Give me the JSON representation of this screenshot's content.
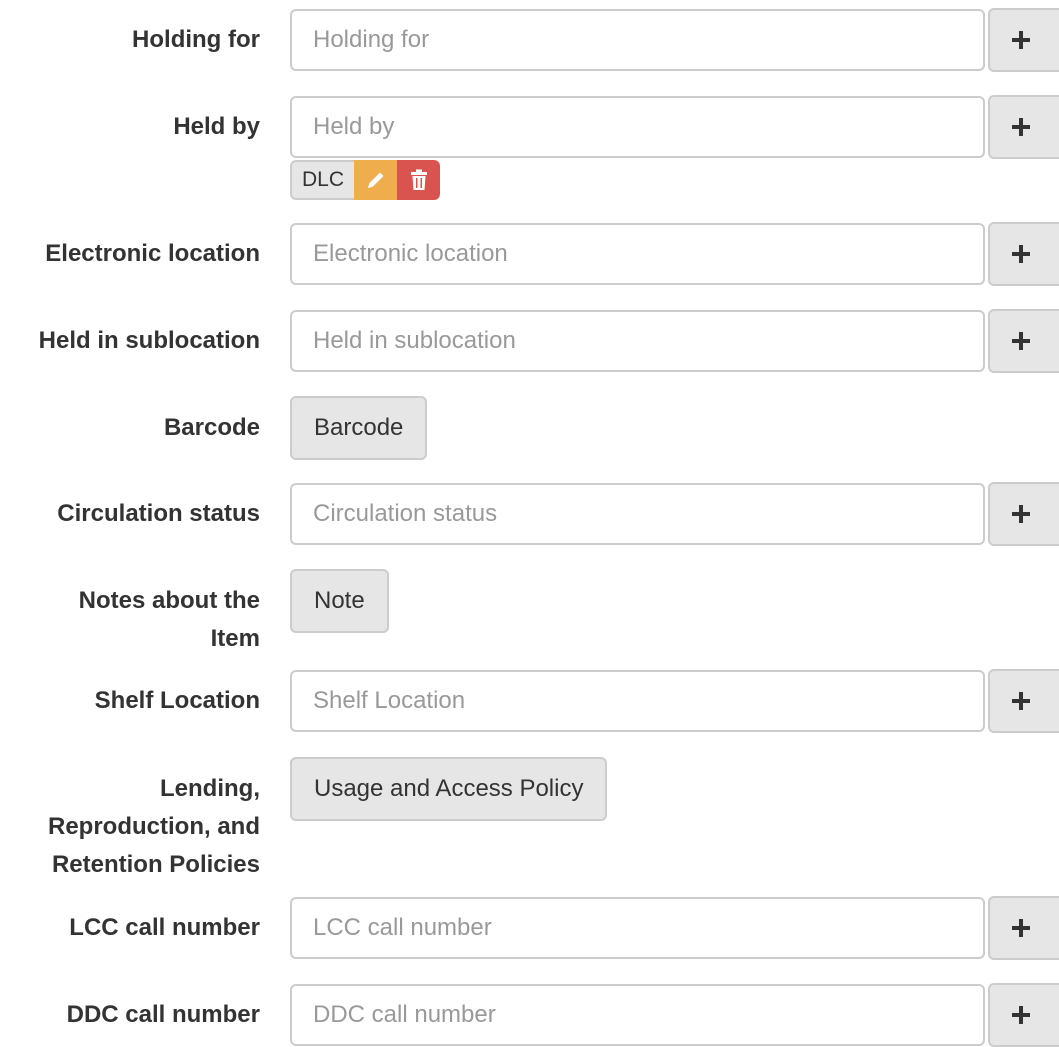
{
  "form": {
    "holding_for": {
      "label": "Holding for",
      "placeholder": "Holding for"
    },
    "held_by": {
      "label": "Held by",
      "placeholder": "Held by",
      "tag": {
        "text": "DLC",
        "edit_icon": "pencil-icon",
        "delete_icon": "trash-icon"
      }
    },
    "electronic_location": {
      "label": "Electronic location",
      "placeholder": "Electronic location"
    },
    "held_in_sublocation": {
      "label": "Held in sublocation",
      "placeholder": "Held in sublocation"
    },
    "barcode": {
      "label": "Barcode",
      "button": "Barcode"
    },
    "circulation_status": {
      "label": "Circulation status",
      "placeholder": "Circulation status"
    },
    "notes": {
      "label_line1": "Notes about the",
      "label_line2": "Item",
      "button": "Note"
    },
    "shelf_location": {
      "label": "Shelf Location",
      "placeholder": "Shelf Location"
    },
    "policies": {
      "label_line1": "Lending,",
      "label_line2": "Reproduction, and",
      "label_line3": "Retention Policies",
      "button": "Usage and Access Policy"
    },
    "lcc_call_number": {
      "label": "LCC call number",
      "placeholder": "LCC call number"
    },
    "ddc_call_number": {
      "label": "DDC call number",
      "placeholder": "DDC call number"
    }
  },
  "colors": {
    "edit": "#f0ad4e",
    "delete": "#d9534f",
    "button_bg": "#e6e6e6",
    "border": "#cccccc"
  },
  "icons": {
    "add": "plus-icon",
    "edit": "pencil-icon",
    "delete": "trash-icon"
  }
}
